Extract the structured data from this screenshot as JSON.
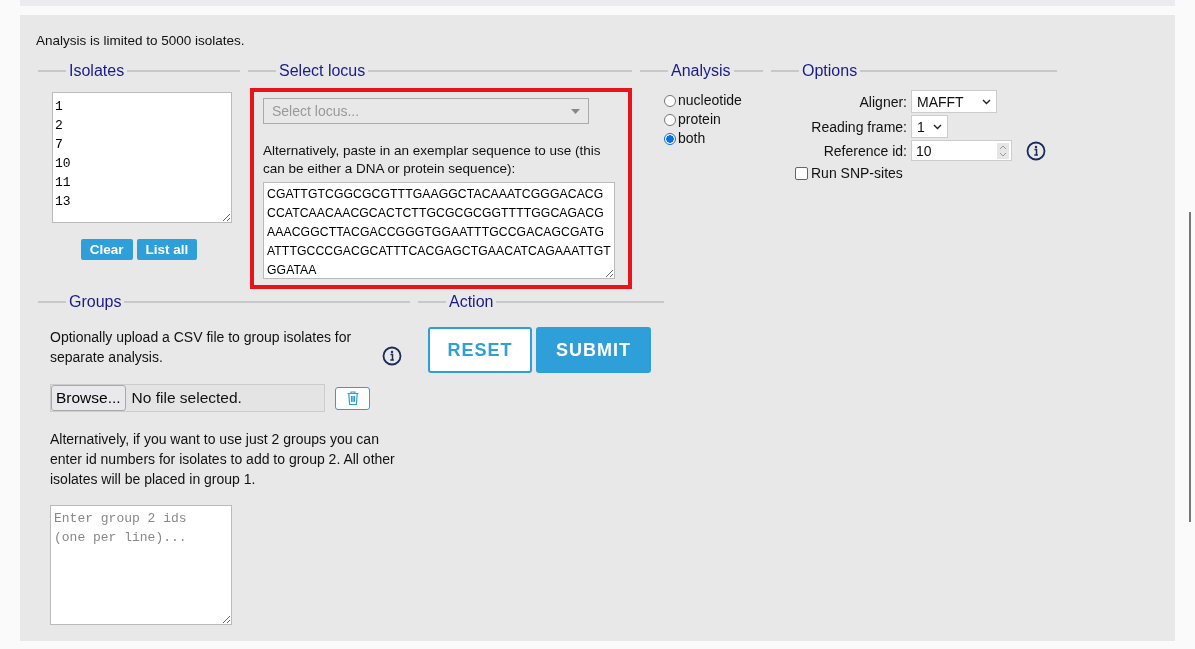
{
  "notice": "Analysis is limited to 5000 isolates.",
  "isolates": {
    "legend": "Isolates",
    "ids": [
      "1",
      "2",
      "7",
      "10",
      "11",
      "13"
    ],
    "buttons": [
      "Clear",
      "List all"
    ]
  },
  "locus": {
    "legend": "Select locus",
    "highlighted": true,
    "select_placeholder": "Select locus...",
    "hint": "Alternatively, paste in an exemplar sequence to use (this can be either a DNA or protein sequence):",
    "sequence": "CGATTGTCGGCGCGTTTGAAGGCTACAAATCGGGACACGCCATCAACAACGCACTCTTGCGCGCGGTTTTGGCAGACGAAACGGCTTACGACCGGGTGGAATTTGCCGACAGCGATGATTTGCCCGACGCATTTCACGAGCTGAACATCAGAAATTGTGGATAA"
  },
  "analysis": {
    "legend": "Analysis",
    "options": [
      {
        "label": "nucleotide",
        "selected": false
      },
      {
        "label": "protein",
        "selected": false
      },
      {
        "label": "both",
        "selected": true
      }
    ]
  },
  "options": {
    "legend": "Options",
    "aligner_label": "Aligner:",
    "aligner": "MAFFT",
    "frame_label": "Reading frame:",
    "frame": "1",
    "ref_label": "Reference id:",
    "ref": "10",
    "snp_label": "Run SNP-sites",
    "snp_checked": false
  },
  "groups": {
    "legend": "Groups",
    "upload_text": "Optionally upload a CSV file to group isolates for separate analysis.",
    "browse": "Browse...",
    "file_status": "No file selected.",
    "alt_text": "Alternatively, if you want to use just 2 groups you can enter id numbers for isolates to add to group 2. All other isolates will be placed in group 1.",
    "placeholder": "Enter group 2 ids\n(one per line)..."
  },
  "action": {
    "legend": "Action",
    "reset": "RESET",
    "submit": "SUBMIT"
  }
}
